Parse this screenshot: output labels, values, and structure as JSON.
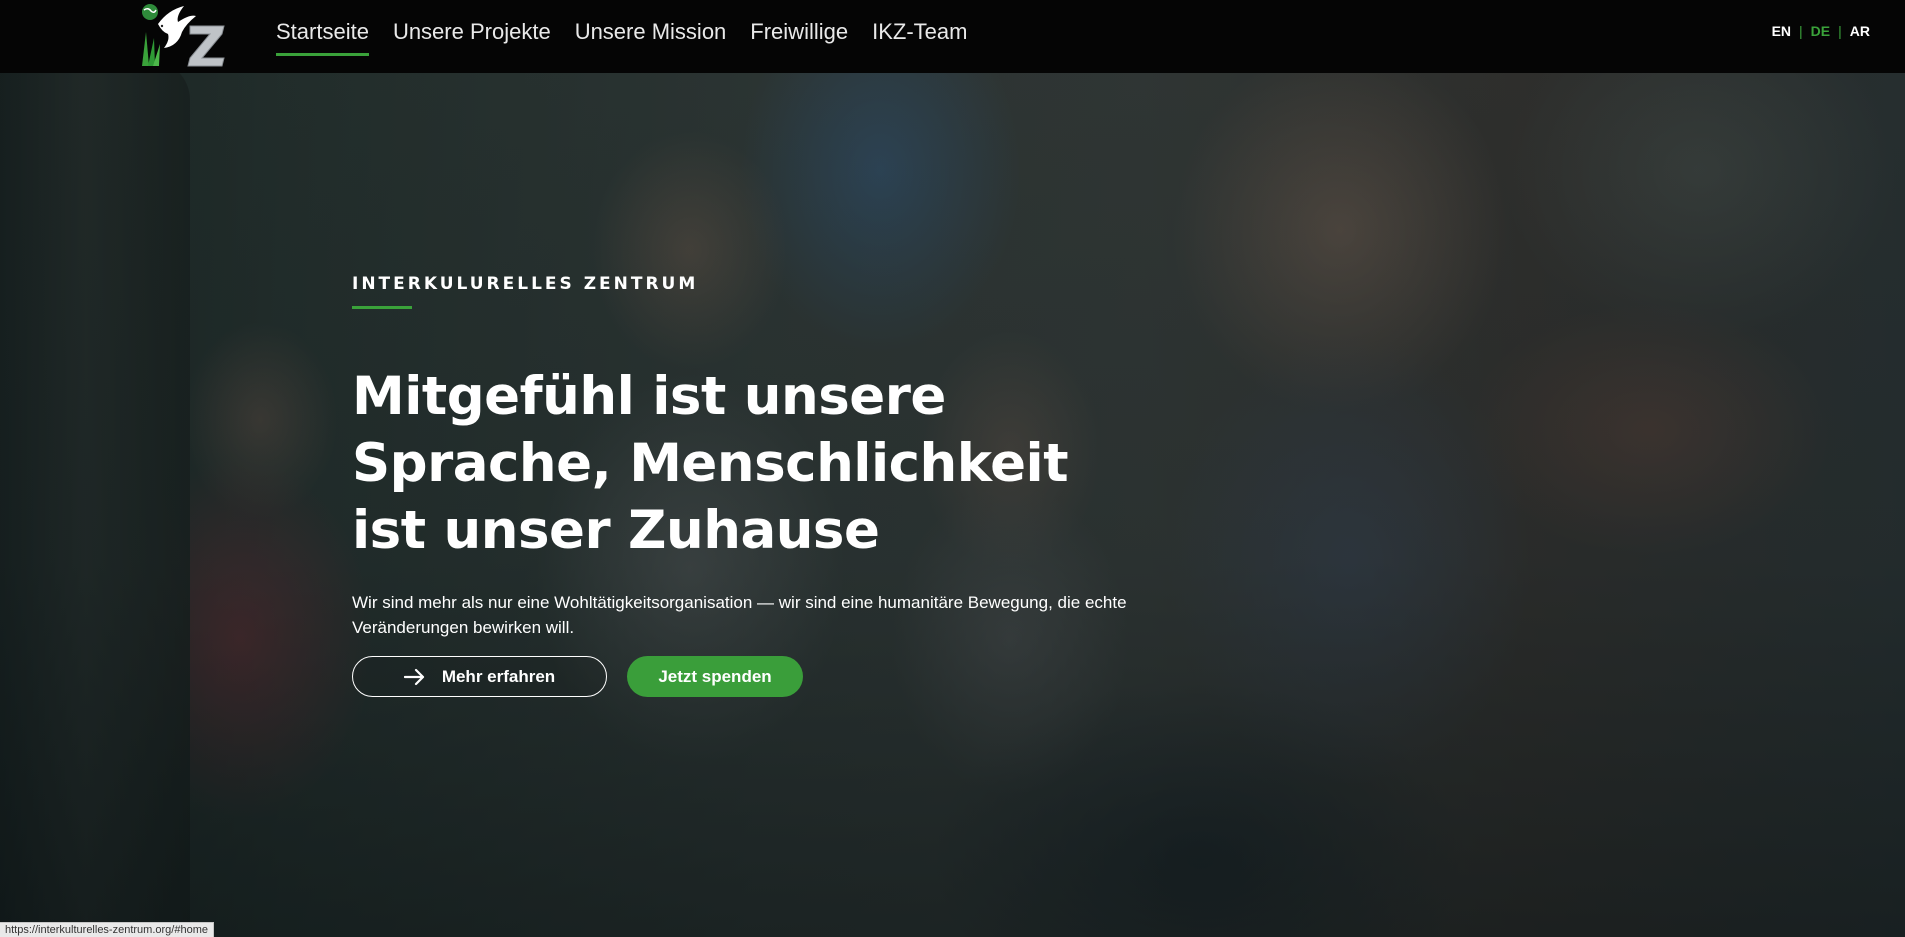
{
  "brand": {
    "logo_text": "Z",
    "logo_icon": "dove-globe-logo"
  },
  "nav": {
    "items": [
      {
        "label": "Startseite",
        "active": true
      },
      {
        "label": "Unsere Projekte",
        "active": false
      },
      {
        "label": "Unsere Mission",
        "active": false
      },
      {
        "label": "Freiwillige",
        "active": false
      },
      {
        "label": "IKZ-Team",
        "active": false
      }
    ]
  },
  "languages": {
    "options": [
      "EN",
      "DE",
      "AR"
    ],
    "current": "DE",
    "separator": "|"
  },
  "hero": {
    "eyebrow": "INTERKULURELLES ZENTRUM",
    "headline_lines": [
      "Mitgefühl ist unsere",
      "Sprache, Menschlichkeit",
      "ist unser Zuhause"
    ],
    "subtext": "Wir sind mehr als nur eine Wohltätigkeitsorganisation — wir sind eine humanitäre Bewegung, die echte Veränderungen bewirken will.",
    "primary_button": {
      "label": "Mehr erfahren",
      "icon": "arrow-right-icon"
    },
    "secondary_button": {
      "label": "Jetzt spenden"
    }
  },
  "status_bar": {
    "url": "https://interkulturelles-zentrum.org/#home"
  },
  "colors": {
    "accent": "#3aa23a",
    "navbar": "#050505",
    "text": "#ffffff"
  }
}
